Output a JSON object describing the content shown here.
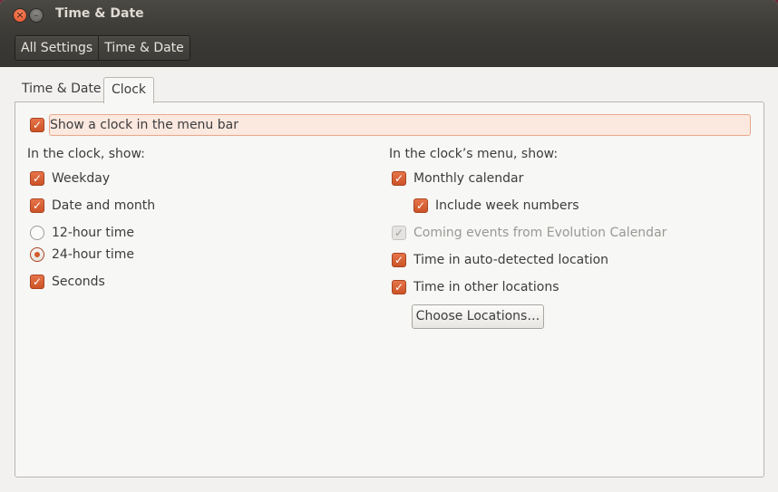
{
  "window": {
    "title": "Time & Date",
    "close_glyph": "×",
    "minimize_glyph": "–"
  },
  "toolbar": {
    "breadcrumbs": [
      "All Settings",
      "Time & Date"
    ]
  },
  "tabs": [
    {
      "label": "Time & Date",
      "active": false
    },
    {
      "label": "Clock",
      "active": true
    }
  ],
  "clock_tab": {
    "show_in_menubar": {
      "label": "Show a clock in the menu bar",
      "checked": true
    },
    "left": {
      "heading": "In the clock, show:",
      "weekday": {
        "label": "Weekday",
        "checked": true
      },
      "date_month": {
        "label": "Date and month",
        "checked": true
      },
      "hour12": {
        "label": "12-hour time",
        "selected": false
      },
      "hour24": {
        "label": "24-hour time",
        "selected": true
      },
      "seconds": {
        "label": "Seconds",
        "checked": true
      }
    },
    "right": {
      "heading": "In the clock’s menu, show:",
      "monthly_calendar": {
        "label": "Monthly calendar",
        "checked": true
      },
      "week_numbers": {
        "label": "Include week numbers",
        "checked": true
      },
      "evolution": {
        "label": "Coming events from Evolution Calendar",
        "checked": true,
        "disabled": true
      },
      "auto_location": {
        "label": "Time in auto-detected location",
        "checked": true
      },
      "other_locations": {
        "label": "Time in other locations",
        "checked": true
      },
      "choose_button": "Choose Locations…"
    }
  },
  "colors": {
    "accent": "#dd6132",
    "titlebar": "#3d3b37",
    "background": "#f2f1f0"
  },
  "icons": {
    "check": "✓"
  }
}
